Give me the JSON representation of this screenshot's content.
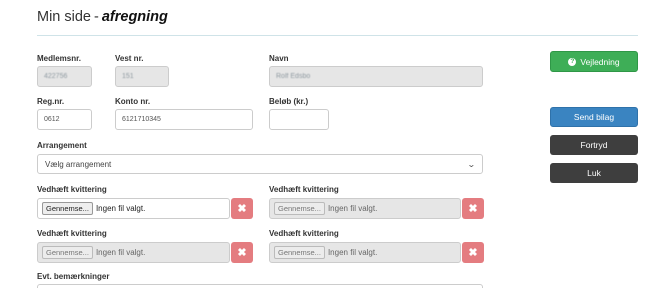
{
  "header": {
    "title_prefix": "Min side",
    "title_separator": "-",
    "title_emphasis": "afregning"
  },
  "form": {
    "medlemsnr": {
      "label": "Medlemsnr.",
      "value": "422756"
    },
    "vest_nr": {
      "label": "Vest nr.",
      "value": "151"
    },
    "navn": {
      "label": "Navn",
      "value": "Rolf Edsbo"
    },
    "reg_nr": {
      "label": "Reg.nr.",
      "value": "0612"
    },
    "konto_nr": {
      "label": "Konto nr.",
      "value": "6121710345"
    },
    "beloeb": {
      "label": "Beløb (kr.)",
      "value": ""
    },
    "arrangement": {
      "label": "Arrangement",
      "selected": "Vælg arrangement"
    },
    "attachments": [
      {
        "label": "Vedhæft kvittering",
        "browse": "Gennemse...",
        "filename": "Ingen fil valgt.",
        "enabled": true
      },
      {
        "label": "Vedhæft kvittering",
        "browse": "Gennemse...",
        "filename": "Ingen fil valgt.",
        "enabled": false
      },
      {
        "label": "Vedhæft kvittering",
        "browse": "Gennemse...",
        "filename": "Ingen fil valgt.",
        "enabled": false
      },
      {
        "label": "Vedhæft kvittering",
        "browse": "Gennemse...",
        "filename": "Ingen fil valgt.",
        "enabled": false
      }
    ],
    "remove_icon": "✖",
    "remarks": {
      "label": "Evt. bemærkninger"
    }
  },
  "sidebar": {
    "help_label": "Vejledning",
    "help_icon": "?",
    "send_label": "Send bilag",
    "cancel_label": "Fortryd",
    "close_label": "Luk"
  },
  "colors": {
    "help": "#3eae57",
    "send": "#3a84c1",
    "dark": "#3e3e3e",
    "remove": "#e47c80"
  }
}
